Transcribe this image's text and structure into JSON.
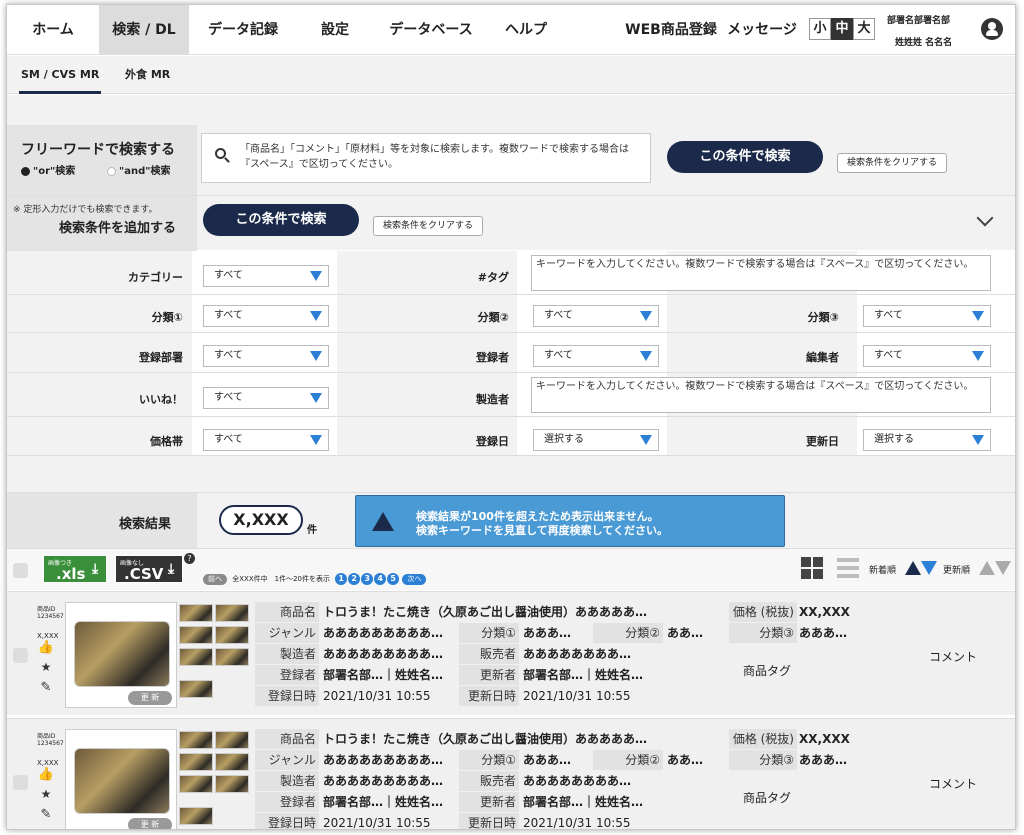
{
  "nav": {
    "items": [
      "ホーム",
      "検索 / DL",
      "データ記録",
      "設定",
      "データベース",
      "ヘルプ",
      "WEB商品登録",
      "メッセージ"
    ],
    "size": [
      "小",
      "中",
      "大"
    ],
    "user_dept": "部署名部署名部",
    "user_name": "姓姓姓 名名名"
  },
  "subnav": {
    "items": [
      "SM / CVS MR",
      "外食 MR"
    ]
  },
  "freeword": {
    "title": "フリーワードで検索する",
    "or_label": "\"or\"検索",
    "and_label": "\"and\"検索",
    "placeholder": "「商品名」「コメント」「原材料」等を対象に検索します。複数ワードで検索する場合は『スペース』で区切ってください。",
    "search_button": "この条件で検索",
    "clear_button": "検索条件をクリアする"
  },
  "addcond": {
    "note": "※ 定形入力だけでも検索できます。",
    "title": "検索条件を追加する",
    "search_button": "この条件で検索",
    "clear_button": "検索条件をクリアする"
  },
  "filters": {
    "category_label": "カテゴリー",
    "category_value": "すべて",
    "tag_label": "#タグ",
    "tag_placeholder": "キーワードを入力してください。複数ワードで検索する場合は『スペース』で区切ってください。",
    "class1_label": "分類①",
    "class1_value": "すべて",
    "class2_label": "分類②",
    "class2_value": "すべて",
    "class3_label": "分類③",
    "class3_value": "すべて",
    "dept_label": "登録部署",
    "dept_value": "すべて",
    "registrant_label": "登録者",
    "registrant_value": "すべて",
    "editor_label": "編集者",
    "editor_value": "すべて",
    "like_label": "いいね！",
    "like_value": "すべて",
    "maker_label": "製造者",
    "maker_placeholder": "キーワードを入力してください。複数ワードで検索する場合は『スペース』で区切ってください。",
    "price_label": "価格帯",
    "price_value": "すべて",
    "regdate_label": "登録日",
    "regdate_value": "選択する",
    "update_label": "更新日",
    "update_value": "選択する"
  },
  "results": {
    "label": "検索結果",
    "count": "X,XXX",
    "count_unit": "件",
    "warning_line1": "検索結果が100件を超えたため表示出来ません。",
    "warning_line2": "検索キーワードを見直して再度検索してください。",
    "xls_small": "画像つき",
    "xls_label": ".xls",
    "csv_small": "画像なし",
    "csv_label": ".CSV",
    "help": "?",
    "prev": "前へ",
    "range": "全XXX件中　1件～20件を表示",
    "pages": [
      "1",
      "2",
      "3",
      "4",
      "5"
    ],
    "next": "次へ",
    "sort_new": "新着順",
    "sort_update": "更新順"
  },
  "card_labels": {
    "name": "商品名",
    "genre": "ジャンル",
    "maker": "製造者",
    "registrant": "登録者",
    "regdate": "登録日時",
    "class1": "分類①",
    "class2": "分類②",
    "seller": "販売者",
    "updater": "更新者",
    "updatedate": "更新日時",
    "price": "価格 (税抜)",
    "class3": "分類③",
    "tag": "商品タグ",
    "comment": "コメント",
    "update_btn": "更 新"
  },
  "cards": [
    {
      "code1": "商品ID",
      "code2": "1234567",
      "likes": "X,XXX",
      "name": "トロうま！たこ焼き（久原あご出し醤油使用）あああああ…",
      "genre": "あああああああああ…",
      "class1": "あああ…",
      "class2": "ああ…",
      "maker": "あああああああああ…",
      "seller": "ああああああああ…",
      "registrant": "部署名部…｜姓姓名…",
      "updater": "部署名部…｜姓姓名…",
      "regdate": "2021/10/31 10:55",
      "updatedate": "2021/10/31 10:55",
      "price": "XX,XXX",
      "class3": "あああ…"
    },
    {
      "code1": "商品ID",
      "code2": "1234567",
      "likes": "X,XXX",
      "name": "トロうま！たこ焼き（久原あご出し醤油使用）あああああ…",
      "genre": "あああああああああ…",
      "class1": "あああ…",
      "class2": "ああ…",
      "maker": "あああああああああ…",
      "seller": "ああああああああ…",
      "registrant": "部署名部…｜姓姓名…",
      "updater": "部署名部…｜姓姓名…",
      "regdate": "2021/10/31 10:55",
      "updatedate": "2021/10/31 10:55",
      "price": "XX,XXX",
      "class3": "あああ…"
    }
  ],
  "colors": {
    "navy": "#1b2a4a",
    "blue": "#2b7fd4",
    "warning": "#4a9ad6"
  }
}
